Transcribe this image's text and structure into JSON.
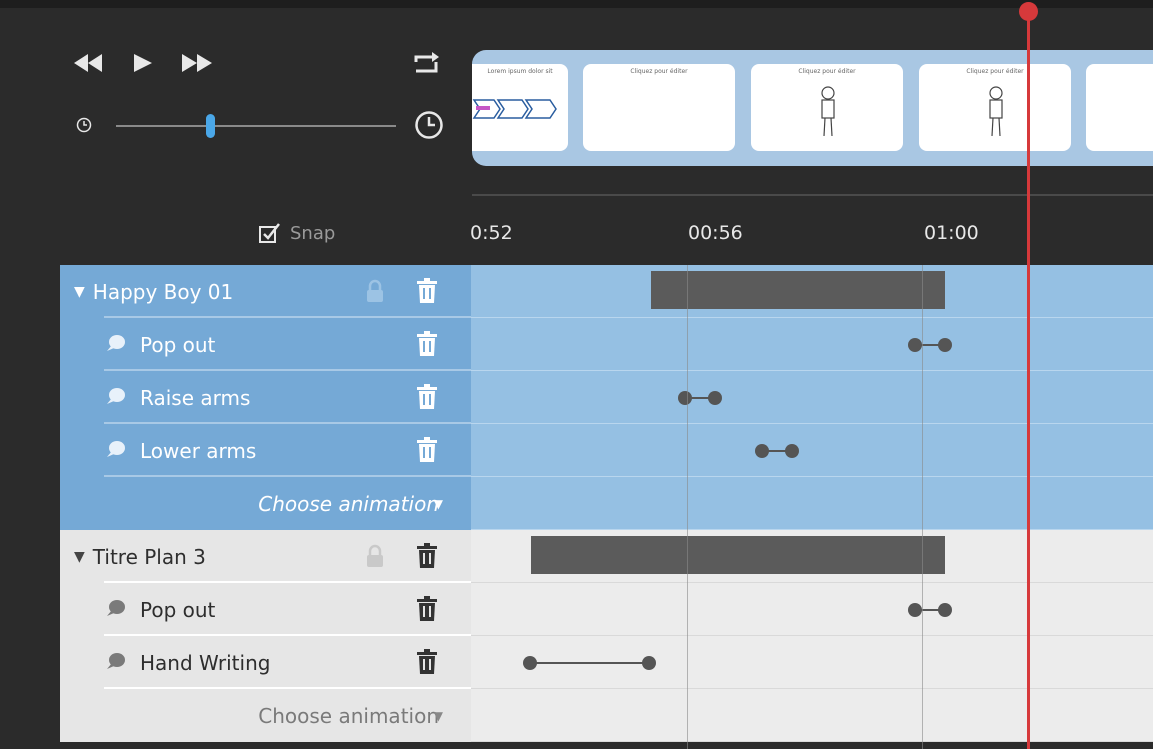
{
  "transport": {
    "rewind_icon": "rewind-icon",
    "play_icon": "play-icon",
    "forward_icon": "fast-forward-icon",
    "loop_icon": "loop-icon",
    "zoom_slider_value": 0.33
  },
  "scenes": [
    {
      "title": "Lorem ipsum dolor sit"
    },
    {
      "title": "Cliquez pour éditer"
    },
    {
      "title": "Cliquez pour éditer"
    },
    {
      "title": "Cliquez pour éditer"
    }
  ],
  "snap": {
    "label": "Snap",
    "checked": true
  },
  "ruler": {
    "ticks": [
      "0:52",
      "00:56",
      "01:00"
    ]
  },
  "groups": [
    {
      "name": "Happy Boy 01",
      "color": "#75a9d6",
      "animations": [
        {
          "label": "Pop out"
        },
        {
          "label": "Raise arms"
        },
        {
          "label": "Lower arms"
        }
      ],
      "choose_label": "Choose animation"
    },
    {
      "name": "Titre Plan 3",
      "color": "#e6e6e6",
      "animations": [
        {
          "label": "Pop out"
        },
        {
          "label": "Hand Writing"
        }
      ],
      "choose_label": "Choose animation"
    }
  ],
  "colors": {
    "playhead": "#d6393b",
    "accent": "#4aa7e8"
  }
}
